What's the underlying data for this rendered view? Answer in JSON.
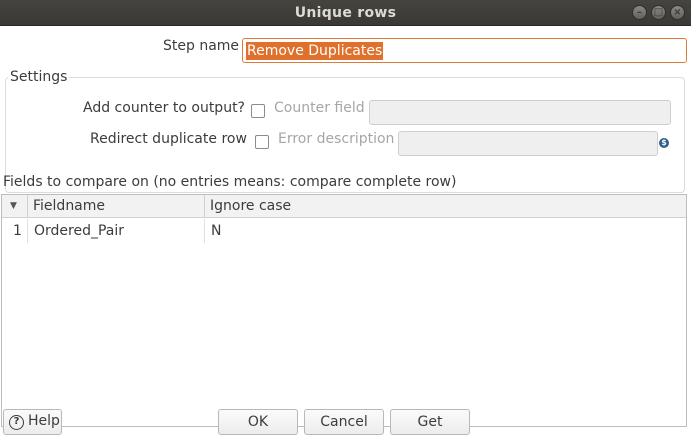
{
  "window": {
    "title": "Unique rows",
    "controls": {
      "minimize": "–",
      "maximize": "□",
      "close": "×"
    }
  },
  "step_name": {
    "label": "Step name",
    "value": "Remove Duplicates"
  },
  "settings": {
    "group_title": "Settings",
    "add_counter_label": "Add counter to output?",
    "add_counter_checked": false,
    "counter_field_label": "Counter field",
    "counter_field_value": "",
    "redirect_label": "Redirect duplicate row",
    "redirect_checked": false,
    "error_description_label": "Error description",
    "error_description_value": "",
    "variable_icon": "$"
  },
  "fields": {
    "title": "Fields to compare on (no entries means: compare complete row)",
    "columns": [
      "Fieldname",
      "Ignore case"
    ],
    "rows": [
      {
        "index": "1",
        "fieldname": "Ordered_Pair",
        "ignore_case": "N"
      }
    ]
  },
  "buttons": {
    "help": "Help",
    "help_icon": "?",
    "ok": "OK",
    "cancel": "Cancel",
    "get": "Get"
  }
}
